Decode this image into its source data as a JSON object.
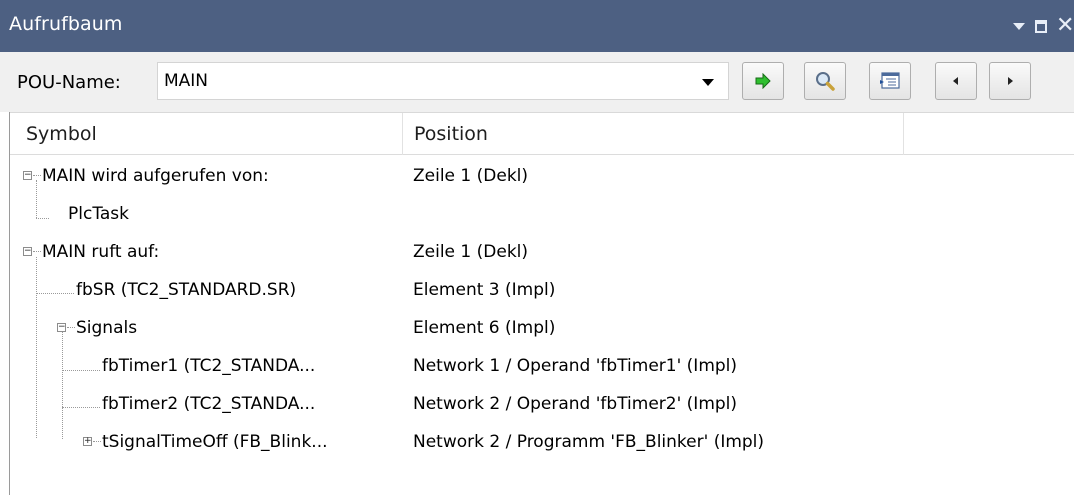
{
  "panel": {
    "title": "Aufrufbaum",
    "controls": {
      "dropdown_icon": "triangle-down-icon",
      "maximize_icon": "maximize-icon",
      "close_label": "✕"
    }
  },
  "toolbar": {
    "pou_label": "POU-Name:",
    "pou_value": "MAIN",
    "buttons": [
      {
        "name": "go-to-definition-button",
        "icon": "green-arrow-icon"
      },
      {
        "name": "search-button",
        "icon": "magnifier-icon"
      },
      {
        "name": "show-tree-button",
        "icon": "tree-view-icon"
      },
      {
        "name": "back-button",
        "icon": "left-arrow-icon"
      },
      {
        "name": "forward-button",
        "icon": "right-arrow-icon"
      }
    ]
  },
  "columns": {
    "symbol": "Symbol",
    "position": "Position"
  },
  "rows": [
    {
      "symbol": "MAIN wird aufgerufen von:",
      "position": "Zeile 1 (Dekl)",
      "level": 0,
      "expander": "−"
    },
    {
      "symbol": "PlcTask",
      "position": "",
      "level": 1,
      "expander": ""
    },
    {
      "symbol": "MAIN ruft auf:",
      "position": "Zeile 1 (Dekl)",
      "level": 0,
      "expander": "−"
    },
    {
      "symbol": "fbSR (TC2_STANDARD.SR)",
      "position": "Element 3 (Impl)",
      "level": 1,
      "expander": ""
    },
    {
      "symbol": "Signals",
      "position": "Element 6 (Impl)",
      "level": 1,
      "expander": "−"
    },
    {
      "symbol": "fbTimer1 (TC2_STANDA...",
      "position": "Network 1 / Operand 'fbTimer1' (Impl)",
      "level": 2,
      "expander": ""
    },
    {
      "symbol": "fbTimer2 (TC2_STANDA...",
      "position": "Network 2 / Operand 'fbTimer2' (Impl)",
      "level": 2,
      "expander": ""
    },
    {
      "symbol": "tSignalTimeOff (FB_Blink...",
      "position": "Network 2 / Programm 'FB_Blinker' (Impl)",
      "level": 2,
      "expander": "+"
    }
  ]
}
